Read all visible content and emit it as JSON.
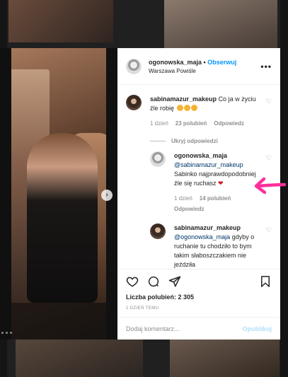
{
  "post": {
    "username": "ogonowska_maja",
    "separator": "•",
    "follow_label": "Obserwuj",
    "location": "Warszawa Powiśle"
  },
  "comments": {
    "top": {
      "username": "sabinamazur_makeup",
      "text": "Co ja w życiu źle robię",
      "time": "1 dzień",
      "likes": "23 polubień",
      "reply_label": "Odpowiedz"
    },
    "hide_replies_label": "Ukryj odpowiedzi",
    "reply1": {
      "username": "ogonowska_maja",
      "mention": "@sabinamazur_makeup",
      "text": "Sabinko najprawdopodobniej źle się ruchasz",
      "heart": "❤",
      "time": "1 dzień",
      "likes": "14 polubień",
      "reply_label": "Odpowiedz"
    },
    "reply2": {
      "username": "sabinamazur_makeup",
      "mention": "@ogonowska_maja",
      "text": "gdyby o ruchanie tu chodziło to bym takim słaboszczakiem nie jeździła"
    }
  },
  "actions": {
    "likes_text": "Liczba polubień: 2 305",
    "date": "1 DZIEŃ TEMU"
  },
  "composer": {
    "placeholder": "Dodaj komentarz...",
    "publish_label": "Opublikuj"
  },
  "colors": {
    "accent": "#0095f6",
    "annotation": "#ff2e9b",
    "heart": "#d8192c"
  }
}
